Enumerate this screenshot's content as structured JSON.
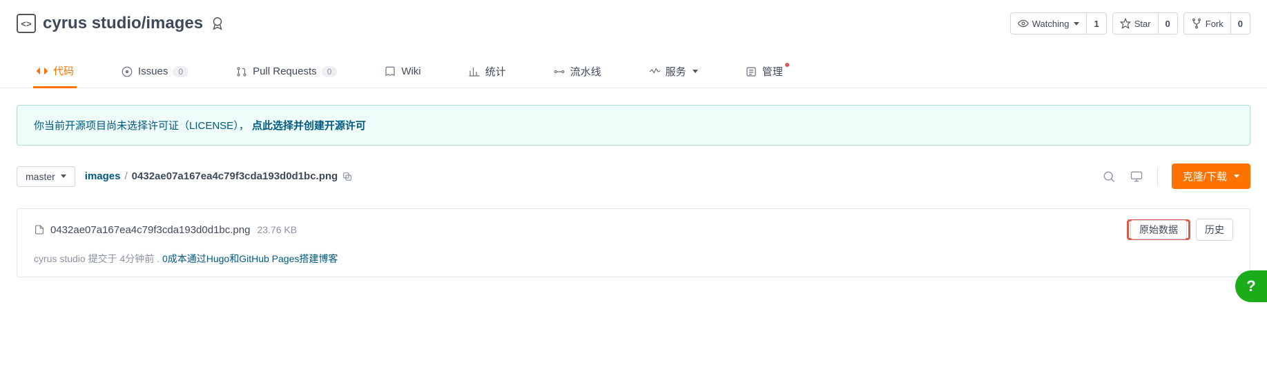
{
  "repo": {
    "owner": "cyrus studio",
    "name": "images",
    "full_title": "cyrus studio/images"
  },
  "header_actions": {
    "watch": {
      "label": "Watching",
      "count": "1"
    },
    "star": {
      "label": "Star",
      "count": "0"
    },
    "fork": {
      "label": "Fork",
      "count": "0"
    }
  },
  "tabs": {
    "code": "代码",
    "issues": {
      "label": "Issues",
      "count": "0"
    },
    "pull_requests": {
      "label": "Pull Requests",
      "count": "0"
    },
    "wiki": "Wiki",
    "stats": "统计",
    "pipelines": "流水线",
    "services": "服务",
    "manage": "管理"
  },
  "notice": {
    "prefix": "你当前开源项目尚未选择许可证（LICENSE），",
    "bold": "点此选择并创建开源许可"
  },
  "branch": {
    "selected": "master"
  },
  "breadcrumb": {
    "root": "images",
    "sep": "/",
    "file": "0432ae07a167ea4c79f3cda193d0d1bc.png"
  },
  "clone_button": "克隆/下载",
  "file": {
    "name": "0432ae07a167ea4c79f3cda193d0d1bc.png",
    "size": "23.76 KB",
    "raw_button": "原始数据",
    "history_button": "历史"
  },
  "commit": {
    "author": "cyrus studio",
    "verb": "提交于",
    "when": "4分钟前",
    "dot": ".",
    "message": "0成本通过Hugo和GitHub Pages搭建博客"
  },
  "help": "?"
}
